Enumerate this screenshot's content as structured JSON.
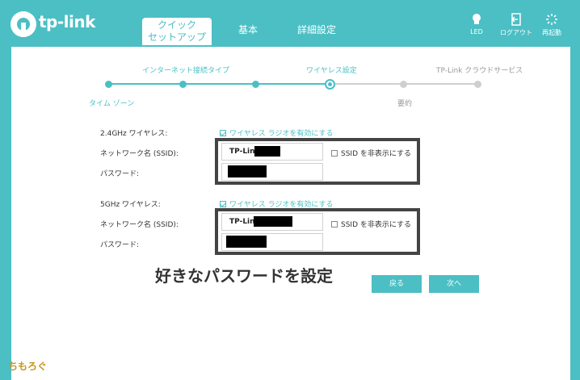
{
  "header": {
    "brand": "tp-link",
    "tabs": [
      {
        "line1": "クイック",
        "line2": "セットアップ"
      },
      {
        "label": "基本"
      },
      {
        "label": "詳細設定"
      }
    ],
    "tools": [
      {
        "label": "LED",
        "icon": "bulb-icon"
      },
      {
        "label": "ログアウト",
        "icon": "logout-icon"
      },
      {
        "label": "再起動",
        "icon": "reboot-icon"
      }
    ]
  },
  "progress": {
    "steps": [
      "タイム ゾーン",
      "インターネット接続タイプ",
      "ワイヤレス設定",
      "要約",
      "TP-Link クラウドサービス"
    ]
  },
  "wireless24": {
    "band_label": "2.4GHz ワイヤレス:",
    "enable_label": "ワイヤレス ラジオを有効にする",
    "ssid_label": "ネットワーク名 (SSID):",
    "ssid_value": "TP-Link",
    "hide_label": "SSID を非表示にする",
    "password_label": "パスワード:"
  },
  "wireless5": {
    "band_label": "5GHz ワイヤレス:",
    "enable_label": "ワイヤレス ラジオを有効にする",
    "ssid_label": "ネットワーク名 (SSID):",
    "ssid_value": "TP-Link",
    "hide_label": "SSID を非表示にする",
    "password_label": "パスワード:"
  },
  "caption": "好きなパスワードを設定",
  "buttons": {
    "back": "戻る",
    "next": "次へ"
  },
  "watermark": "ちもろぐ",
  "colors": {
    "accent": "#4bbfc4",
    "frame": "#444444"
  }
}
